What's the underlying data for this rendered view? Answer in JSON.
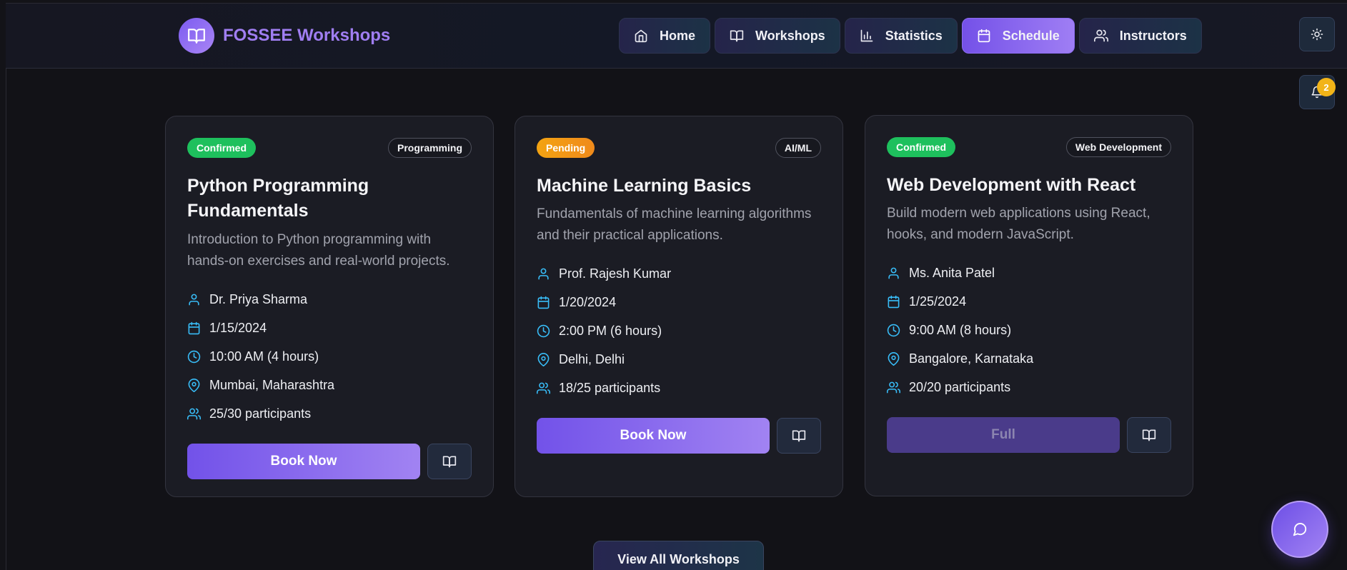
{
  "app": {
    "logo_text": "FOSSEE Workshops"
  },
  "nav": [
    {
      "label": "Home",
      "icon": "home-icon",
      "active": false
    },
    {
      "label": "Workshops",
      "icon": "book-icon",
      "active": false
    },
    {
      "label": "Statistics",
      "icon": "bar-chart-icon",
      "active": false
    },
    {
      "label": "Schedule",
      "icon": "calendar-icon",
      "active": true
    },
    {
      "label": "Instructors",
      "icon": "users-icon",
      "active": false
    }
  ],
  "notifications": {
    "count": "2"
  },
  "cards": [
    {
      "status": "Confirmed",
      "category": "Programming",
      "title": "Python Programming Fundamentals",
      "description": "Introduction to Python programming with hands-on exercises and real-world projects.",
      "instructor": "Dr. Priya Sharma",
      "date": "1/15/2024",
      "time": "10:00 AM (4 hours)",
      "location": "Mumbai, Maharashtra",
      "participants": "25/30 participants",
      "action_label": "Book Now"
    },
    {
      "status": "Pending",
      "category": "AI/ML",
      "title": "Machine Learning Basics",
      "description": "Fundamentals of machine learning algorithms and their practical applications.",
      "instructor": "Prof. Rajesh Kumar",
      "date": "1/20/2024",
      "time": "2:00 PM (6 hours)",
      "location": "Delhi, Delhi",
      "participants": "18/25 participants",
      "action_label": "Book Now"
    },
    {
      "status": "Confirmed",
      "category": "Web Development",
      "title": "Web Development with React",
      "description": "Build modern web applications using React, hooks, and modern JavaScript.",
      "instructor": "Ms. Anita Patel",
      "date": "1/25/2024",
      "time": "9:00 AM (8 hours)",
      "location": "Bangalore, Karnataka",
      "participants": "20/20 participants",
      "action_label": "Full"
    }
  ],
  "view_all_label": "View All Workshops",
  "colors": {
    "accent": "#7c5cf0",
    "confirmed": "#1ec05d",
    "pending": "#f3a312",
    "icon_cyan": "#38bdf8"
  }
}
